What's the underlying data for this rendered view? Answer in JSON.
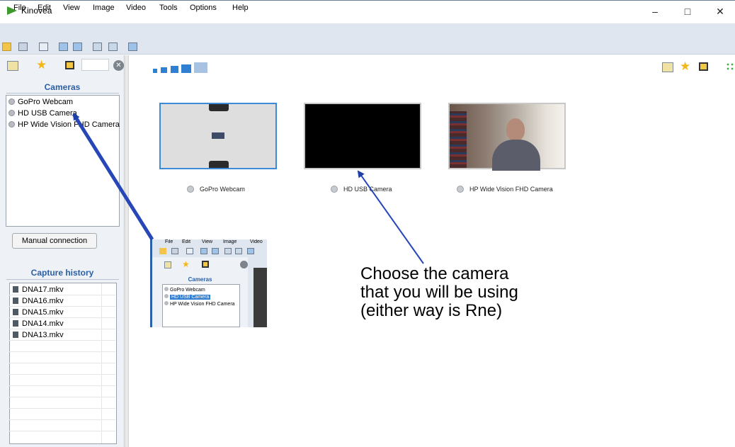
{
  "window": {
    "title": "Kinovea",
    "minimize": "–",
    "maximize": "□",
    "close": "✕"
  },
  "menu": [
    "File",
    "Edit",
    "View",
    "Image",
    "Video",
    "Tools",
    "Options",
    "Help"
  ],
  "cameras": {
    "header": "Cameras",
    "items": [
      "GoPro Webcam",
      "HD USB Camera",
      "HP Wide Vision FHD Camera"
    ],
    "manual_connection": "Manual connection"
  },
  "history": {
    "header": "Capture history",
    "items": [
      "DNA17.mkv",
      "DNA16.mkv",
      "DNA15.mkv",
      "DNA14.mkv",
      "DNA13.mkv"
    ]
  },
  "thumbnails": [
    {
      "label": "GoPro Webcam",
      "selected": true,
      "preview": "gopro"
    },
    {
      "label": "HD USB Camera",
      "selected": false,
      "preview": "black"
    },
    {
      "label": "HP Wide Vision FHD Camera",
      "selected": false,
      "preview": "webcam-person"
    }
  ],
  "instruction": {
    "lines": [
      "Choose the camera",
      "that you will be using",
      "(either way is Rne)"
    ]
  },
  "inset": {
    "menu": [
      "File",
      "Edit",
      "View",
      "Image",
      "Video"
    ],
    "header": "Cameras",
    "items": [
      "GoPro Webcam",
      "HD USB Camera",
      "HP Wide Vision FHD Camera"
    ],
    "selected_index": 1
  },
  "colors": {
    "accent": "#2f7fd2",
    "arrow": "#1f3fa8",
    "header_text": "#2a5fa6",
    "menubar": "#dfe6ef"
  }
}
